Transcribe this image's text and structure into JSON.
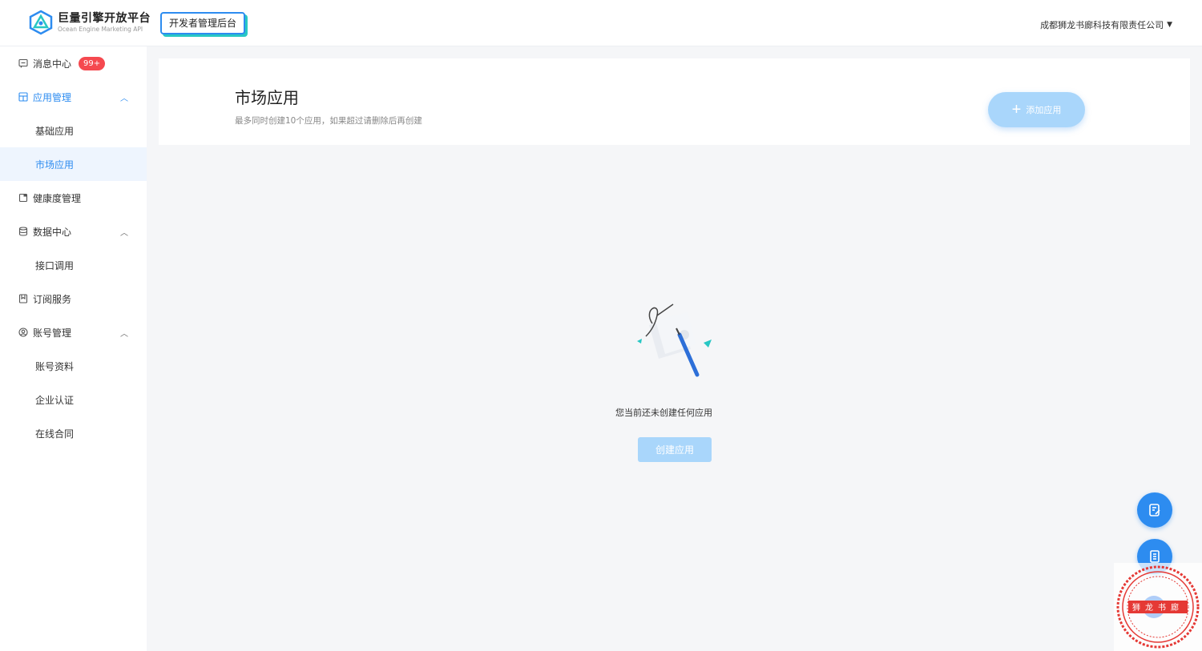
{
  "header": {
    "brand_title": "巨量引擎开放平台",
    "brand_subtitle": "Ocean Engine Marketing API",
    "admin_tag": "开发者管理后台",
    "company": "成都狮龙书廊科技有限责任公司"
  },
  "sidebar": {
    "items": [
      {
        "label": "消息中心",
        "badge": "99+",
        "icon": "message-icon"
      },
      {
        "label": "应用管理",
        "icon": "app-icon",
        "expanded": true,
        "children": [
          "基础应用",
          "市场应用"
        ]
      },
      {
        "label": "健康度管理",
        "icon": "health-icon"
      },
      {
        "label": "数据中心",
        "icon": "database-icon",
        "expanded": true,
        "children": [
          "接口调用"
        ]
      },
      {
        "label": "订阅服务",
        "icon": "bookmark-icon"
      },
      {
        "label": "账号管理",
        "icon": "account-icon",
        "expanded": true,
        "children": [
          "账号资料",
          "企业认证",
          "在线合同"
        ]
      }
    ],
    "active_item": "市场应用"
  },
  "main": {
    "title": "市场应用",
    "description": "最多同时创建10个应用，如果超过请删除后再创建",
    "add_button": "添加应用",
    "empty_text": "您当前还未创建任何应用",
    "create_button": "创建应用"
  },
  "colors": {
    "accent": "#2d8cf0",
    "badge": "#f5494f",
    "disabled_button": "#a9d6fb",
    "seal": "#e53935"
  },
  "floating": {
    "buttons": [
      "edit-document-icon",
      "document-icon"
    ]
  },
  "seal": {
    "text": "狮龙书廊"
  }
}
